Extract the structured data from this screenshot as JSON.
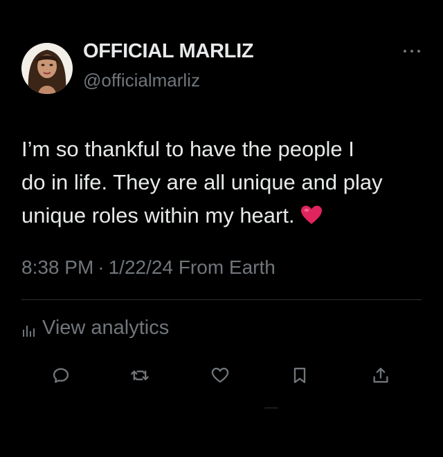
{
  "user": {
    "display_name": "OFFICIAL MARLIZ",
    "handle": "@officialmarliz"
  },
  "tweet": {
    "lines": [
      "I’m so thankful to have the people I",
      "do in life. They are all unique and play",
      "unique roles within my heart."
    ],
    "emoji": "red-heart-emoji"
  },
  "meta": {
    "time": "8:38 PM",
    "separator": "·",
    "date": "1/22/24",
    "source": "From Earth"
  },
  "analytics": {
    "label": "View analytics",
    "icon": "bar-chart-icon"
  },
  "actions": [
    {
      "name": "reply",
      "icon": "reply-icon"
    },
    {
      "name": "retweet",
      "icon": "retweet-icon"
    },
    {
      "name": "like",
      "icon": "heart-icon"
    },
    {
      "name": "bookmark",
      "icon": "bookmark-icon"
    },
    {
      "name": "share",
      "icon": "share-icon"
    }
  ],
  "colors": {
    "background": "#000000",
    "primary_text": "#e7e9ea",
    "secondary_text": "#71767b",
    "divider": "#2f3336",
    "heart": "#e0245e"
  }
}
